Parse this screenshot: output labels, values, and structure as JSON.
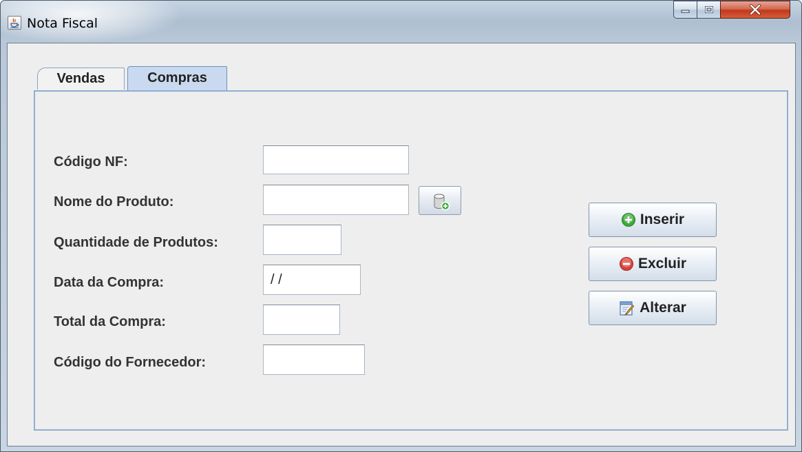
{
  "window": {
    "title": "Nota Fiscal",
    "icon": "java-icon",
    "controls": [
      "minimize-icon",
      "maximize-icon",
      "close-icon"
    ]
  },
  "tabs": [
    {
      "label": "Vendas",
      "selected": false
    },
    {
      "label": "Compras",
      "selected": true
    }
  ],
  "form": {
    "codigo_nf": {
      "label": "Código NF:",
      "value": ""
    },
    "nome_produto": {
      "label": "Nome do Produto:",
      "value": "",
      "lookup_icon": "database-add-icon"
    },
    "quantidade": {
      "label": "Quantidade de Produtos:",
      "value": ""
    },
    "data_compra": {
      "label": "Data da Compra:",
      "value": "/ /"
    },
    "total_compra": {
      "label": "Total da Compra:",
      "value": ""
    },
    "codigo_fornecedor": {
      "label": "Código do Fornecedor:",
      "value": ""
    }
  },
  "actions": {
    "inserir": {
      "label": "Inserir",
      "icon": "add-circle-icon",
      "color": "#3ea83b"
    },
    "excluir": {
      "label": "Excluir",
      "icon": "remove-circle-icon",
      "color": "#d8413a"
    },
    "alterar": {
      "label": "Alterar",
      "icon": "edit-form-icon"
    }
  },
  "colors": {
    "selected_tab": "#c9daf0",
    "panel_border": "#8eaed4",
    "client_bg": "#eeeeee",
    "close_button": "#c0391b"
  }
}
